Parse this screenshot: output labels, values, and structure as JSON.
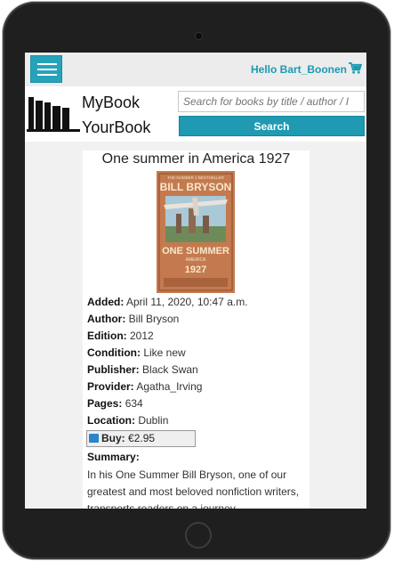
{
  "topbar": {
    "greeting": "Hello Bart_Boonen",
    "menu_icon": "hamburger-icon",
    "cart_icon": "cart-icon"
  },
  "header": {
    "brand_line1": "MyBook",
    "brand_line2": "YourBook",
    "search_placeholder": "Search for books by title / author / I",
    "search_label": "Search"
  },
  "book": {
    "title": "One summer in America 1927",
    "cover": {
      "banner": "THE NUMBER 1 BESTSELLER",
      "author": "BILL BRYSON",
      "title_line1": "ONE SUMMER",
      "title_line2": "AMERICA",
      "title_line3": "1927"
    },
    "details": [
      {
        "label": "Added:",
        "value": "April 11, 2020, 10:47 a.m."
      },
      {
        "label": "Author:",
        "value": "Bill Bryson"
      },
      {
        "label": "Edition:",
        "value": "2012"
      },
      {
        "label": "Condition:",
        "value": "Like new"
      },
      {
        "label": "Publisher:",
        "value": "Black Swan"
      },
      {
        "label": "Provider:",
        "value": "Agatha_Irving"
      },
      {
        "label": "Pages:",
        "value": "634"
      },
      {
        "label": "Location:",
        "value": "Dublin"
      }
    ],
    "buy_label": "Buy:",
    "price": "€2.95",
    "summary_label": "Summary:",
    "summary": "In his One Summer Bill Bryson, one of our greatest and most beloved nonfiction writers, transports readers on a journey"
  },
  "colors": {
    "accent": "#1f9ab2",
    "screen_bg": "#f1f1f1",
    "frame": "#1f1f1f"
  }
}
